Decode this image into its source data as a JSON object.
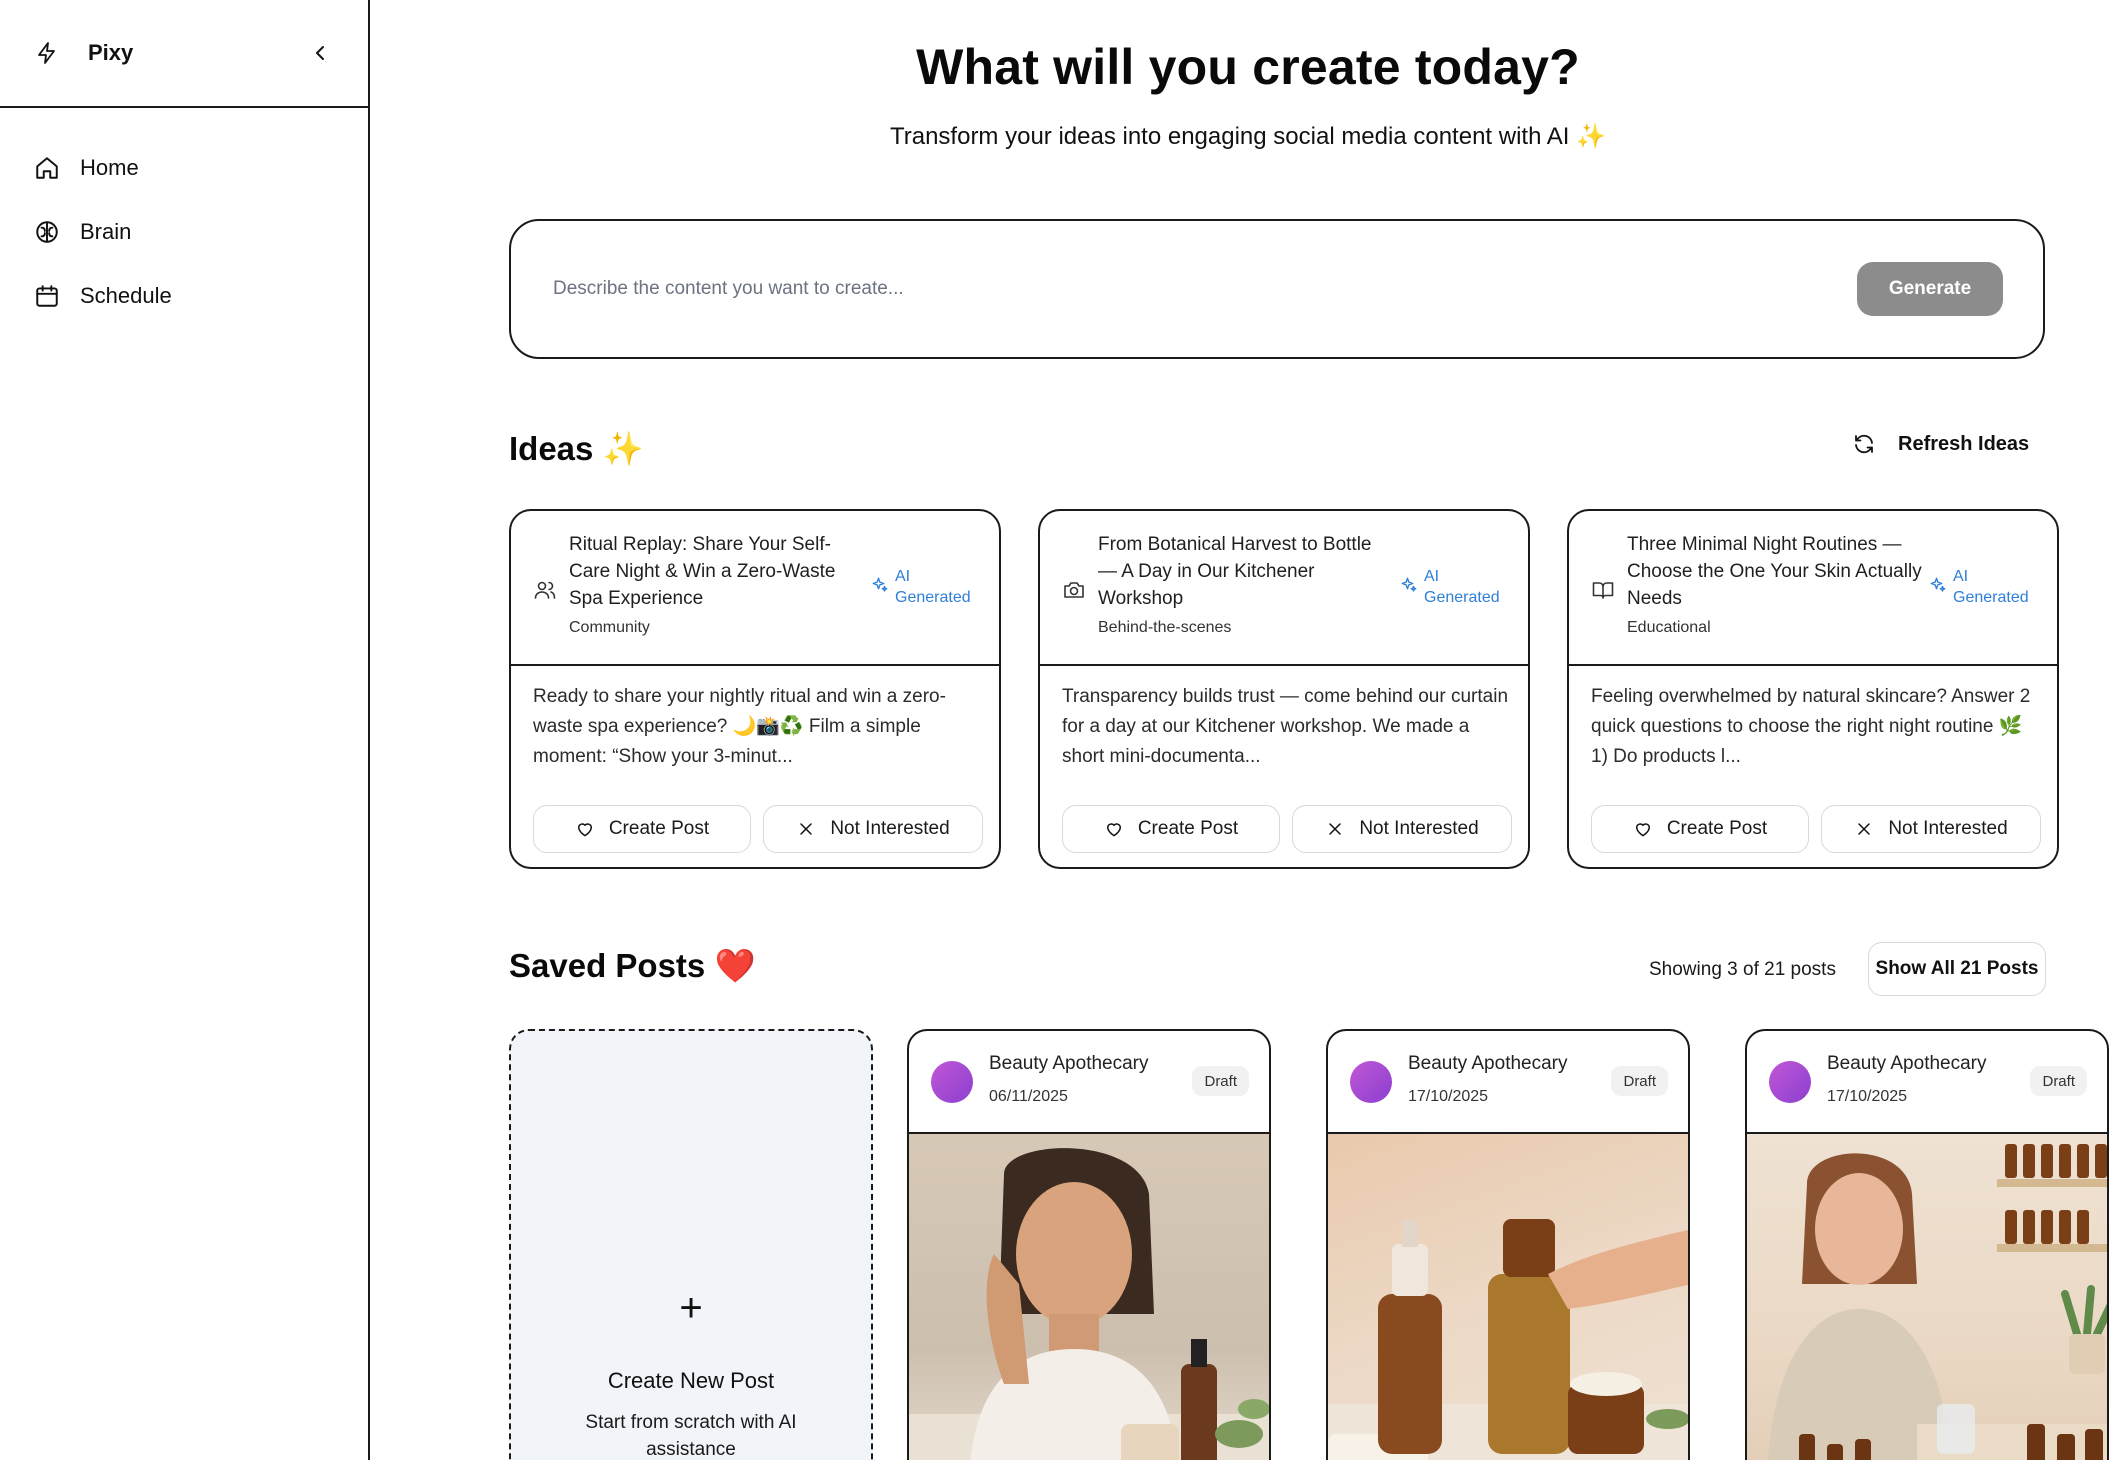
{
  "sidebar": {
    "app_name": "Pixy",
    "items": [
      {
        "label": "Home",
        "icon": "home-icon"
      },
      {
        "label": "Brain",
        "icon": "brain-icon"
      },
      {
        "label": "Schedule",
        "icon": "calendar-icon"
      }
    ]
  },
  "hero": {
    "title": "What will you create today?",
    "subtitle": "Transform your ideas into engaging social media content with AI",
    "sparkle": "✨"
  },
  "prompt": {
    "placeholder": "Describe the content you want to create...",
    "generate_label": "Generate"
  },
  "ideas": {
    "title": "Ideas",
    "sparkle": "✨",
    "refresh_label": "Refresh Ideas",
    "ai_badge_line1": "AI",
    "ai_badge_line2": "Generated",
    "create_label": "Create Post",
    "not_interested_label": "Not Interested",
    "cards": [
      {
        "title": "Ritual Replay: Share Your Self-Care Night & Win a Zero-Waste Spa Experience",
        "category": "Community",
        "icon": "users-icon",
        "body": "Ready to share your nightly ritual and win a zero-waste spa experience? 🌙📸♻️ Film a simple moment: “Show your 3-minut..."
      },
      {
        "title": "From Botanical Harvest to Bottle — A Day in Our Kitchener Workshop",
        "category": "Behind-the-scenes",
        "icon": "camera-icon",
        "body": "Transparency builds trust — come behind our curtain for a day at our Kitchener workshop. We made a short mini-documenta..."
      },
      {
        "title": "Three Minimal Night Routines — Choose the One Your Skin Actually Needs",
        "category": "Educational",
        "icon": "book-icon",
        "body": "Feeling overwhelmed by natural skincare? Answer 2 quick questions to choose the right night routine 🌿 1) Do products l..."
      }
    ]
  },
  "saved": {
    "title": "Saved Posts",
    "heart": "❤️",
    "showing": "Showing 3 of 21 posts",
    "show_all_label": "Show All 21 Posts",
    "new_post": {
      "plus": "+",
      "title": "Create New Post",
      "subtitle": "Start from scratch with AI assistance"
    },
    "posts": [
      {
        "brand": "Beauty Apothecary",
        "date": "06/11/2025",
        "status": "Draft",
        "image": "woman-thinking-with-skincare-products"
      },
      {
        "brand": "Beauty Apothecary",
        "date": "17/10/2025",
        "status": "Draft",
        "image": "amber-skincare-bottles-with-hand"
      },
      {
        "brand": "Beauty Apothecary",
        "date": "17/10/2025",
        "status": "Draft",
        "image": "woman-mixing-skincare-in-workshop"
      }
    ]
  },
  "colors": {
    "accent_blue": "#2f7fd6",
    "generate_button": "#8c8c8c",
    "new_post_bg": "#f1f5f9",
    "avatar_gradient_start": "#c157d6",
    "avatar_gradient_end": "#8b3fd0"
  }
}
